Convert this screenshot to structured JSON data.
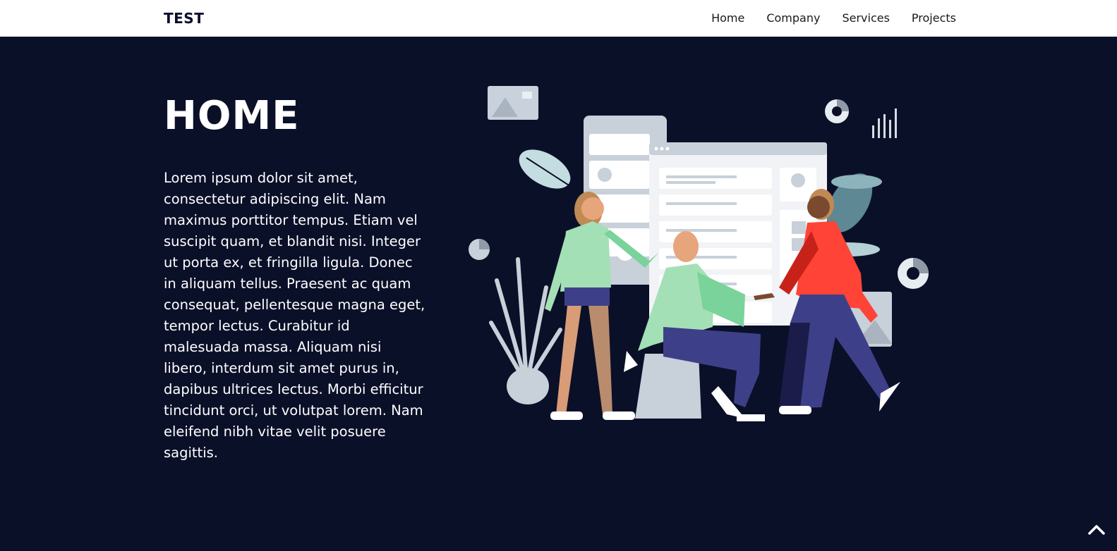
{
  "navbar": {
    "logo": "TEST",
    "links": [
      "Home",
      "Company",
      "Services",
      "Projects"
    ]
  },
  "hero": {
    "title": "HOME",
    "body": "Lorem ipsum dolor sit amet, consectetur adipiscing elit. Nam maximus porttitor tempus. Etiam vel suscipit quam, et blandit nisi. Integer ut porta ex, et fringilla ligula. Donec in aliquam tellus. Praesent ac quam consequat, pellentesque magna eget, tempor lectus. Curabitur id malesuada massa. Aliquam nisi libero, interdum sit amet purus in, dapibus ultrices lectus. Morbi efficitur tincidunt orci, ut volutpat lorem. Nam eleifend nibh vitae velit posuere sagittis."
  },
  "icons": {
    "scroll_top": "chevron-up-icon"
  },
  "colors": {
    "navbar_bg": "#ffffff",
    "hero_bg": "#0b1029",
    "text_light": "#ffffff",
    "text_dark": "#0a0f2b"
  }
}
